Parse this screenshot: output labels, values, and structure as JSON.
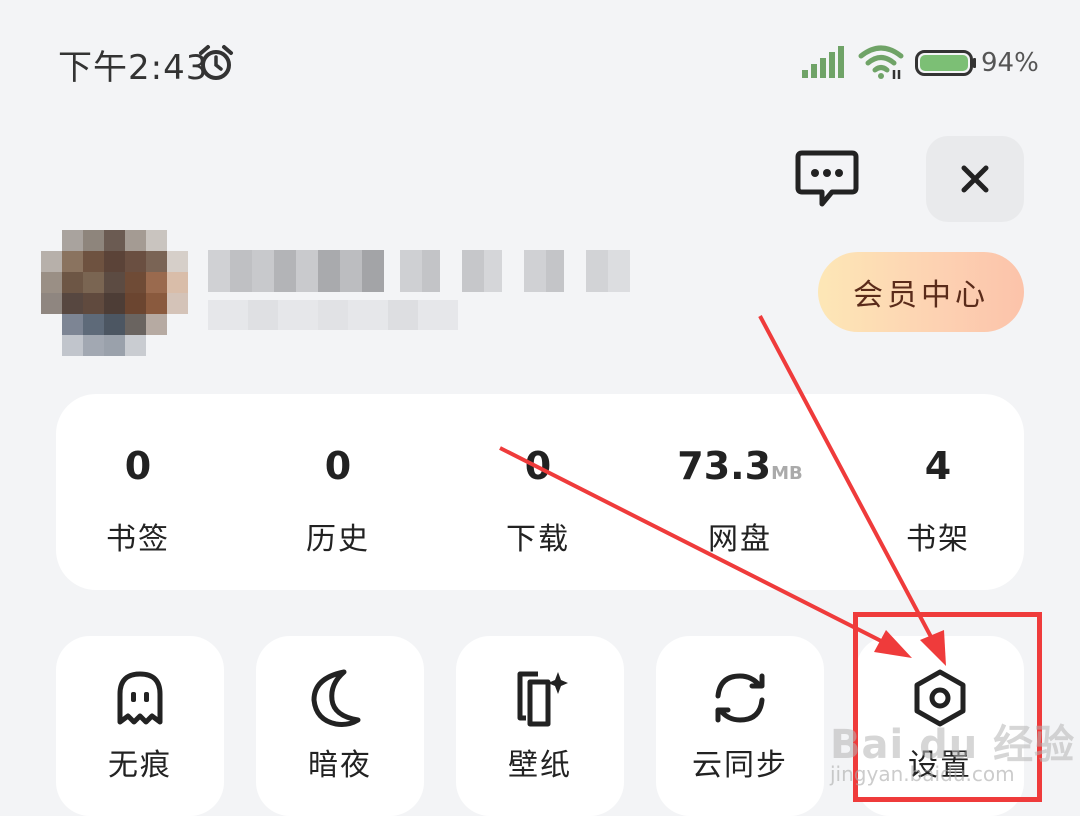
{
  "status_bar": {
    "time": "下午2:43",
    "battery_percent": "94%"
  },
  "header": {
    "message_icon": "message-dots-icon",
    "close_icon": "close-icon"
  },
  "profile": {
    "vip_label": "会员中心"
  },
  "stats": [
    {
      "value": "0",
      "unit": "",
      "label": "书签"
    },
    {
      "value": "0",
      "unit": "",
      "label": "历史"
    },
    {
      "value": "0",
      "unit": "",
      "label": "下载"
    },
    {
      "value": "73.3",
      "unit": "MB",
      "label": "网盘"
    },
    {
      "value": "4",
      "unit": "",
      "label": "书架"
    }
  ],
  "tools": [
    {
      "icon": "ghost-icon",
      "label": "无痕"
    },
    {
      "icon": "moon-icon",
      "label": "暗夜"
    },
    {
      "icon": "wallpaper-icon",
      "label": "壁纸"
    },
    {
      "icon": "sync-icon",
      "label": "云同步"
    },
    {
      "icon": "settings-icon",
      "label": "设置"
    }
  ],
  "watermark": {
    "main": "Bai du 经验",
    "sub": "jingyan.baidu.com"
  },
  "colors": {
    "annotation": "#ef3b3b",
    "vip_gradient_start": "#fde7b6",
    "vip_gradient_end": "#fcc3aa"
  }
}
